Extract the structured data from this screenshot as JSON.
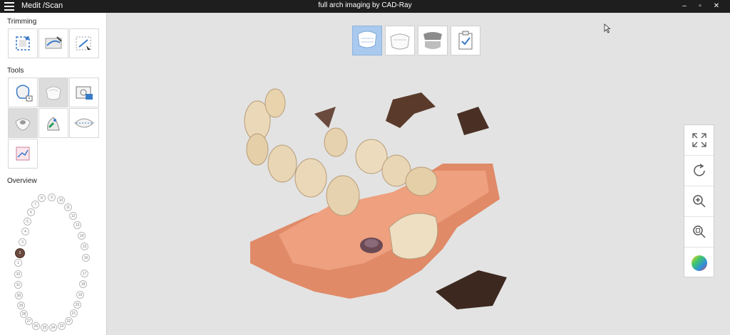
{
  "titlebar": {
    "app_name": "Medit /Scan",
    "document_title": "full arch imaging by CAD-Ray",
    "minimize": "–",
    "restore": "▫",
    "close": "✕"
  },
  "sidebar": {
    "trimming_title": "Trimming",
    "tools_title": "Tools",
    "overview_title": "Overview"
  },
  "overview": {
    "teeth": [
      "8",
      "9",
      "10",
      "11",
      "12",
      "13",
      "14",
      "15",
      "16",
      "17",
      "18",
      "19",
      "20",
      "21",
      "22",
      "23",
      "24",
      "25",
      "26",
      "27",
      "28",
      "29",
      "30",
      "31",
      "32",
      "1",
      "2",
      "3",
      "4",
      "5",
      "6",
      "7"
    ],
    "marked_tooth": "2"
  },
  "icons": {
    "trimming": [
      "select-region-icon",
      "lasso-trim-icon",
      "smart-trim-icon"
    ],
    "tools": [
      "lock-tooth-icon",
      "scan-tool-icon",
      "photo-tool-icon",
      "fill-hole-icon",
      "brush-tool-icon",
      "arch-align-icon",
      "report-icon"
    ],
    "top": [
      "upper-jaw-icon",
      "lower-jaw-icon",
      "occlusion-icon",
      "checklist-icon"
    ],
    "right": [
      "fit-view-icon",
      "rotate-icon",
      "zoom-in-icon",
      "zoom-area-icon",
      "color-map-icon"
    ]
  },
  "colors": {
    "titlebar": "#1e1e1e",
    "active_button": "#a9c9ee",
    "background": "#e3e3e3",
    "marked_tooth": "#6b4a3e"
  }
}
